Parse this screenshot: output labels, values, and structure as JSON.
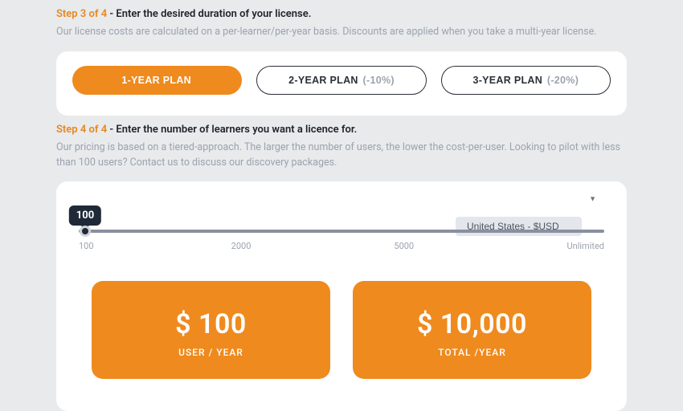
{
  "step3": {
    "prefix": "Step 3 of 4",
    "title": " - Enter the desired duration of your license.",
    "desc": "Our license costs are calculated on a per-learner/per-year basis. Discounts are applied when you take a multi-year license.",
    "plans": [
      {
        "label": "1-YEAR PLAN",
        "discount": ""
      },
      {
        "label": "2-YEAR PLAN",
        "discount": "(-10%)"
      },
      {
        "label": "3-YEAR PLAN",
        "discount": "(-20%)"
      }
    ]
  },
  "step4": {
    "prefix": "Step 4 of 4",
    "title": " - Enter the number of learners you want a licence for.",
    "desc": "Our pricing is based on a tiered-approach. The larger the number of users, the lower the cost-per-user. Looking to pilot with less than 100 users? Contact us to discuss our discovery packages.",
    "currency": "United States - $USD",
    "slider": {
      "value": "100",
      "ticks": [
        "100",
        "2000",
        "5000",
        "Unlimited"
      ]
    },
    "prices": [
      {
        "amount": "$ 100",
        "label": "USER / YEAR"
      },
      {
        "amount": "$ 10,000",
        "label": "TOTAL /YEAR"
      }
    ]
  }
}
